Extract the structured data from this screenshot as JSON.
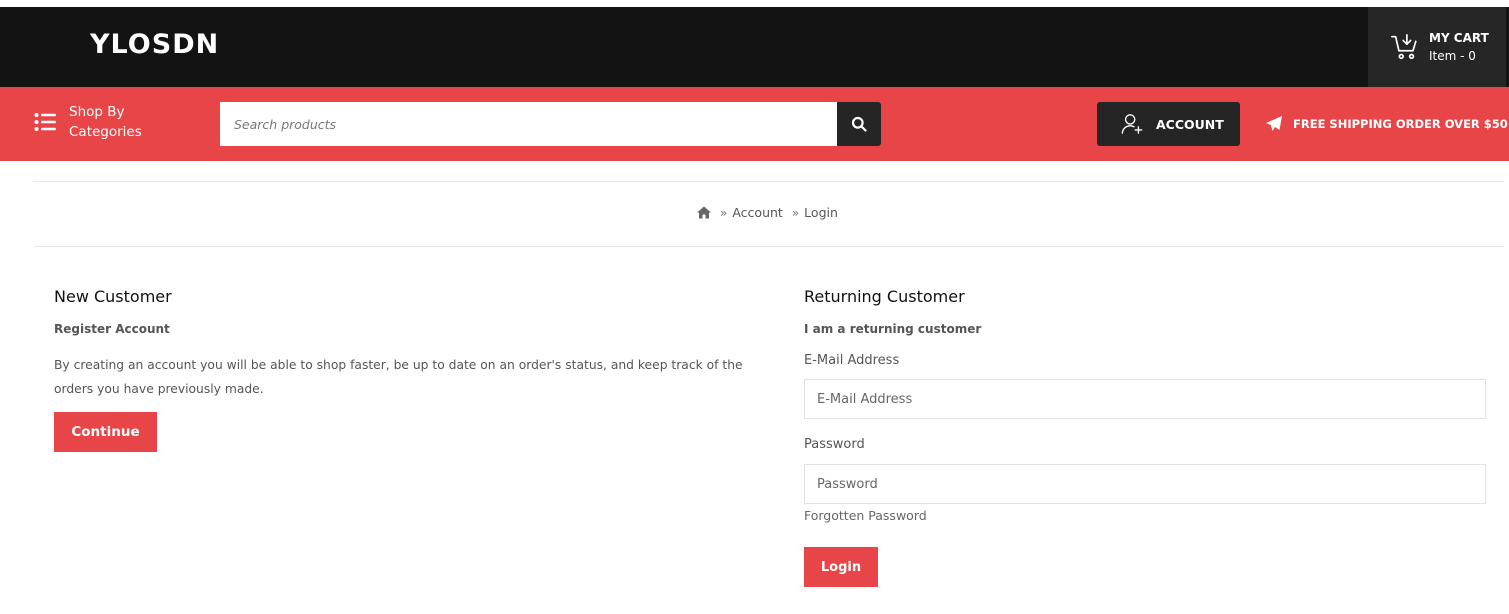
{
  "header": {
    "logo": "YLOSDN",
    "cart_title": "MY CART",
    "cart_count": "Item - 0"
  },
  "nav": {
    "categories_label": "Shop By Categories",
    "search_placeholder": "Search products",
    "account_label": "ACCOUNT",
    "shipping_text": "FREE SHIPPING ORDER OVER $50"
  },
  "breadcrumb": {
    "items": [
      "Account",
      "Login"
    ]
  },
  "new_customer": {
    "title": "New Customer",
    "subtitle": "Register Account",
    "description": "By creating an account you will be able to shop faster, be up to date on an order's status, and keep track of the orders you have previously made.",
    "button": "Continue"
  },
  "returning_customer": {
    "title": "Returning Customer",
    "subtitle": "I am a returning customer",
    "email_label": "E-Mail Address",
    "email_placeholder": "E-Mail Address",
    "password_label": "Password",
    "password_placeholder": "Password",
    "forgot_link": "Forgotten Password",
    "button": "Login"
  },
  "colors": {
    "accent": "#e84548",
    "dark": "#131313",
    "button_dark": "#252525"
  },
  "icons": {
    "cart": "cart-icon",
    "categories": "list-icon",
    "search": "search-icon",
    "account": "user-add-icon",
    "shipping": "paper-plane-icon",
    "home": "home-icon"
  }
}
